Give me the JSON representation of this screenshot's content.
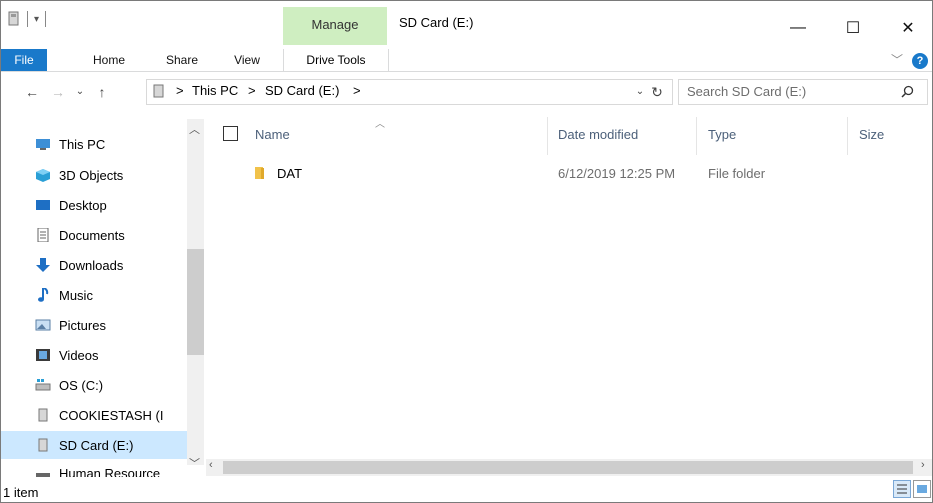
{
  "title": "SD Card (E:)",
  "ribbon": {
    "manage": "Manage",
    "tabs": {
      "file": "File",
      "home": "Home",
      "share": "Share",
      "view": "View",
      "drive_tools": "Drive Tools"
    },
    "help": "?"
  },
  "window_controls": {
    "minimize": "—",
    "maximize": "☐",
    "close": "✕"
  },
  "address": {
    "crumbs": [
      "This PC",
      "SD Card (E:)"
    ],
    "separator": ">",
    "search_placeholder": "Search SD Card (E:)"
  },
  "nav": {
    "items": [
      {
        "label": "This PC",
        "icon": "this-pc-icon"
      },
      {
        "label": "3D Objects",
        "icon": "3d-objects-icon"
      },
      {
        "label": "Desktop",
        "icon": "desktop-icon"
      },
      {
        "label": "Documents",
        "icon": "documents-icon"
      },
      {
        "label": "Downloads",
        "icon": "downloads-icon"
      },
      {
        "label": "Music",
        "icon": "music-icon"
      },
      {
        "label": "Pictures",
        "icon": "pictures-icon"
      },
      {
        "label": "Videos",
        "icon": "videos-icon"
      },
      {
        "label": "OS (C:)",
        "icon": "os-drive-icon"
      },
      {
        "label": "COOKIESTASH (I",
        "icon": "usb-drive-icon"
      },
      {
        "label": "SD Card (E:)",
        "icon": "sd-card-icon"
      },
      {
        "label": "Human Resource",
        "icon": "network-icon"
      }
    ]
  },
  "columns": {
    "name": "Name",
    "date": "Date modified",
    "type": "Type",
    "size": "Size"
  },
  "files": [
    {
      "name": "DAT",
      "date": "6/12/2019 12:25 PM",
      "type": "File folder",
      "size": ""
    }
  ],
  "status": {
    "count": "1 item"
  },
  "colors": {
    "accent": "#1979ca",
    "manage": "#cfeec1",
    "selected": "#cce8ff"
  }
}
